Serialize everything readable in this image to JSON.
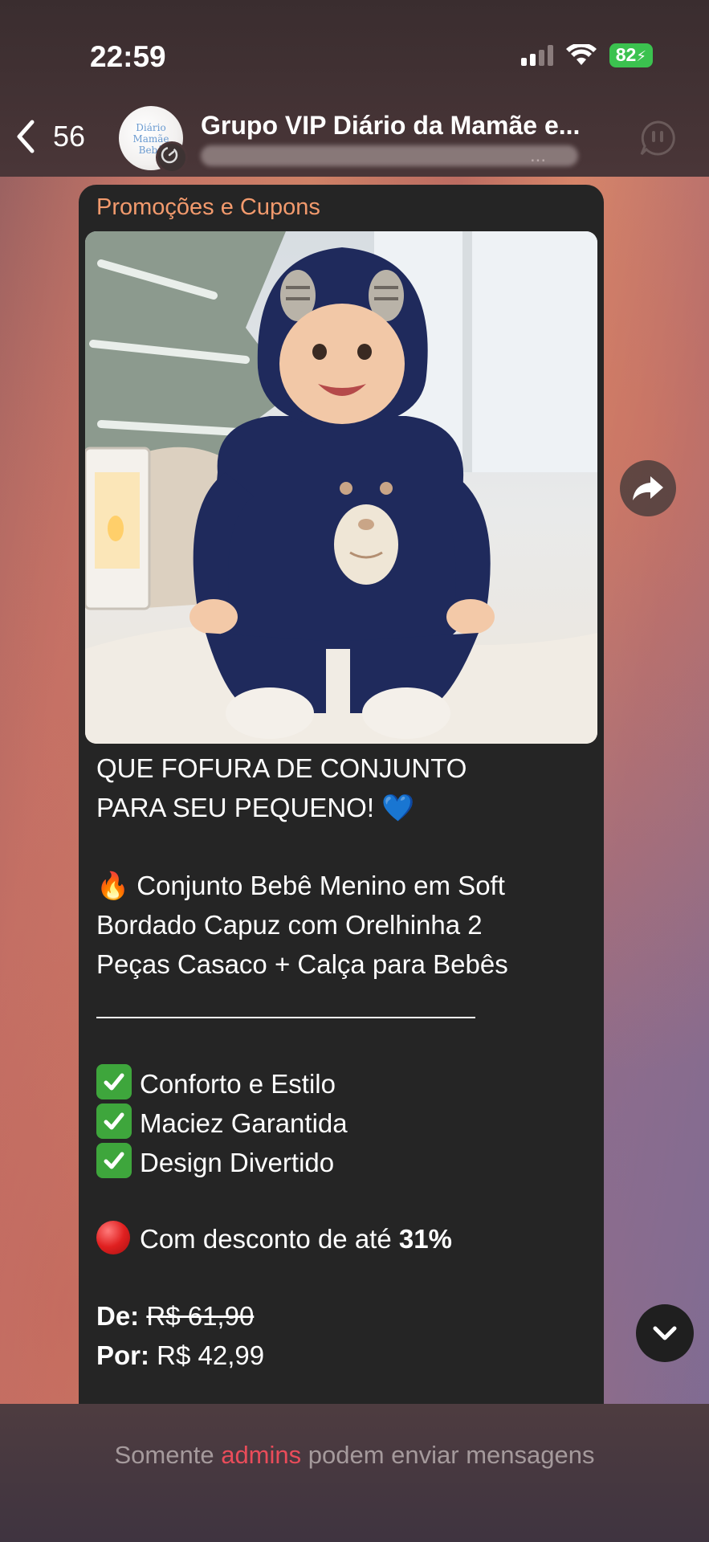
{
  "status_bar": {
    "time": "22:59",
    "battery": "82"
  },
  "header": {
    "back_count": "56",
    "chat_title": "Grupo VIP Diário da Mamãe e...",
    "subtitle_visible_fragment": "...",
    "avatar_logo_lines": [
      "Diário",
      "Mamãe",
      "Bebê"
    ]
  },
  "message": {
    "sender": "Promoções e Cupons",
    "headline_line1": "QUE FOFURA DE CONJUNTO",
    "headline_line2": "PARA SEU PEQUENO! 💙",
    "product_emoji": "🔥",
    "product_line1": "Conjunto Bebê Menino em Soft",
    "product_line2": "Bordado Capuz com Orelhinha 2",
    "product_line3": "Peças Casaco + Calça para Bebês",
    "features": [
      "Conforto e Estilo",
      "Maciez Garantida",
      "Design Divertido"
    ],
    "discount_text": "Com desconto de até",
    "discount_value": "31%",
    "price_from_label": "De:",
    "price_from_value": "R$ 61,90",
    "price_to_label": "Por:",
    "price_to_value": "R$ 42,99"
  },
  "footer": {
    "prefix": "Somente",
    "admins": "admins",
    "suffix": "podem enviar mensagens"
  },
  "colors": {
    "sender": "#f29a6d",
    "admins": "#ea4c5a",
    "check_green": "#3ea63c",
    "battery_green": "#3bc24f"
  },
  "icons": [
    "back-chevron-icon",
    "signal-icon",
    "wifi-icon",
    "battery-icon",
    "voice-chat-icon",
    "forward-icon",
    "scroll-down-icon",
    "check-icon",
    "red-circle-icon"
  ]
}
